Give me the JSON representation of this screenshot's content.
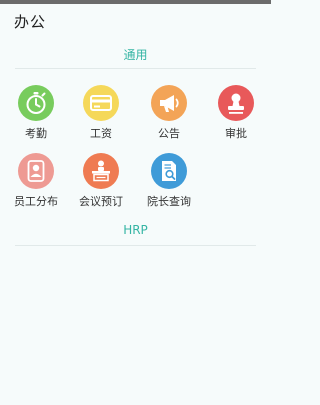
{
  "page": {
    "title": "办公"
  },
  "sections": [
    {
      "header": "通用",
      "apps": [
        {
          "label": "考勤",
          "icon": "stopwatch-icon",
          "color": "#78cc5d"
        },
        {
          "label": "工资",
          "icon": "card-icon",
          "color": "#f5d85a"
        },
        {
          "label": "公告",
          "icon": "megaphone-icon",
          "color": "#f3a457"
        },
        {
          "label": "审批",
          "icon": "stamp-icon",
          "color": "#e8595a"
        },
        {
          "label": "员工分布",
          "icon": "employee-profile-icon",
          "color": "#ee9a93"
        },
        {
          "label": "会议预订",
          "icon": "meeting-icon",
          "color": "#ef7b52"
        },
        {
          "label": "院长查询",
          "icon": "document-search-icon",
          "color": "#3f9bd8"
        }
      ]
    },
    {
      "header": "HRP",
      "apps": []
    }
  ]
}
